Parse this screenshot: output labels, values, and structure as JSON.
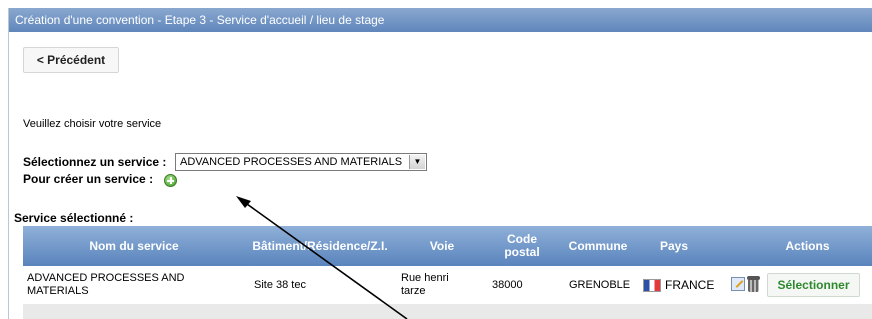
{
  "window": {
    "title": "Création d'une convention - Etape 3 - Service d'accueil / lieu de stage"
  },
  "nav": {
    "previous_label": "< Précédent"
  },
  "form": {
    "instruction": "Veuillez choisir votre service",
    "select_label": "Sélectionnez un service :",
    "select_value": "ADVANCED PROCESSES AND MATERIALS",
    "create_label": "Pour créer un service :"
  },
  "selected": {
    "heading": "Service sélectionné :",
    "columns": [
      "Nom du service",
      "Bâtiment/Résidence/Z.I.",
      "Voie",
      "Code postal",
      "Commune",
      "Pays",
      "Actions"
    ],
    "row": {
      "nom": "ADVANCED PROCESSES AND MATERIALS",
      "batiment": "Site 38 tec",
      "voie": "Rue henri tarze",
      "code_postal": "38000",
      "commune": "GRENOBLE",
      "pays": "FRANCE",
      "action_label": "Sélectionner"
    }
  },
  "icons": {
    "add": "plus-circle-icon",
    "edit": "edit-icon",
    "delete": "trash-icon",
    "flag": "france-flag-icon",
    "dropdown": "chevron-down-icon"
  },
  "colors": {
    "header": "#6f93c6",
    "select_action": "#2f8a2f",
    "add_icon": "#3f9a26"
  }
}
